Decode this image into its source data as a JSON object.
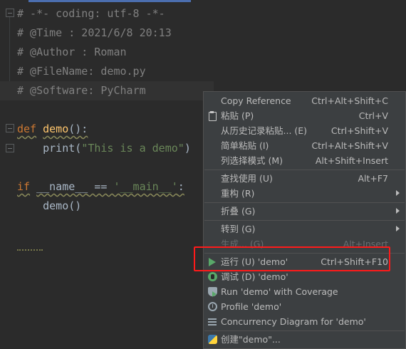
{
  "editor": {
    "lines": {
      "l1": "# -*- coding: utf-8 -*-",
      "l2": "# @Time : 2021/6/8 20:13",
      "l3": "# @Author : Roman",
      "l4": "# @FileName: demo.py",
      "l5": "# @Software: PyCharm",
      "def_kw": "def",
      "def_name": "demo",
      "def_rest": "():",
      "print_fn": "print(",
      "print_str": "\"This is a demo\"",
      "print_close": ")",
      "if_kw": "if",
      "if_name": "__name__",
      "if_eq": " == ",
      "if_str": "'__main__'",
      "if_colon": ":",
      "call": "demo()"
    }
  },
  "context_menu": {
    "items": [
      {
        "label": "Copy Reference",
        "shortcut": "Ctrl+Alt+Shift+C"
      },
      {
        "label": "粘贴 (P)",
        "shortcut": "Ctrl+V"
      },
      {
        "label": "从历史记录粘贴... (E)",
        "shortcut": "Ctrl+Shift+V"
      },
      {
        "label": "简单粘贴 (I)",
        "shortcut": "Ctrl+Alt+Shift+V"
      },
      {
        "label": "列选择模式 (M)",
        "shortcut": "Alt+Shift+Insert"
      },
      {
        "label": "查找使用 (U)",
        "shortcut": "Alt+F7"
      },
      {
        "label": "重构 (R)",
        "shortcut": ""
      },
      {
        "label": "折叠 (G)",
        "shortcut": ""
      },
      {
        "label": "转到 (G)",
        "shortcut": ""
      },
      {
        "label": "生成... (G)",
        "shortcut": "Alt+Insert"
      },
      {
        "label": "运行 (U) 'demo'",
        "shortcut": "Ctrl+Shift+F10"
      },
      {
        "label": "调试 (D) 'demo'",
        "shortcut": ""
      },
      {
        "label": "Run 'demo' with Coverage",
        "shortcut": ""
      },
      {
        "label": "Profile 'demo'",
        "shortcut": ""
      },
      {
        "label": "Concurrency Diagram for 'demo'",
        "shortcut": ""
      },
      {
        "label": "创建\"demo\"...",
        "shortcut": ""
      }
    ]
  },
  "colors": {
    "editor_bg": "#2b2b2b",
    "menu_bg": "#3c3f41",
    "comment": "#808080",
    "keyword": "#cc7832",
    "function": "#ffc66d",
    "string": "#6a8759",
    "highlight_box": "#ff1a1a",
    "run_icon": "#59a869"
  }
}
